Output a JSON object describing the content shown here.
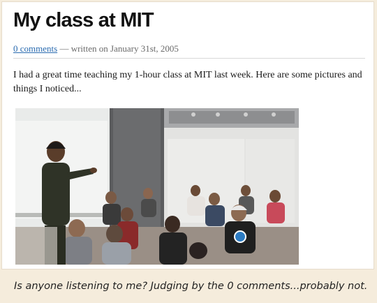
{
  "post": {
    "title": "My class at MIT",
    "comments_link": "0 comments",
    "meta_suffix": " — written on January 31st, 2005",
    "intro": "I had a great time teaching my 1-hour class at MIT last week. Here are some pictures and things I noticed..."
  },
  "photo": {
    "subject": "classroom-photo"
  },
  "caption": "Is anyone listening to me? Judging by the 0 comments...probably not."
}
